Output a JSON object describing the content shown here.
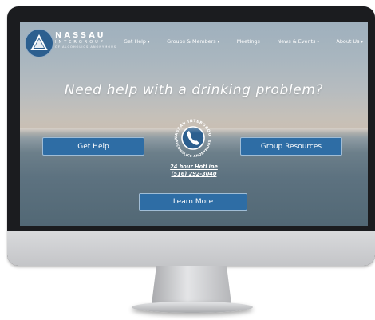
{
  "site": {
    "brand_name": "NASSAU",
    "brand_sub": "INTERGROUP",
    "brand_tag": "OF ALCOHOLICS ANONYMOUS"
  },
  "nav": {
    "items": [
      {
        "label": "Get Help",
        "has_dropdown": true
      },
      {
        "label": "Groups & Members",
        "has_dropdown": true
      },
      {
        "label": "Meetings",
        "has_dropdown": false
      },
      {
        "label": "News & Events",
        "has_dropdown": true
      },
      {
        "label": "About Us",
        "has_dropdown": true
      }
    ],
    "caret": "▾"
  },
  "hero": {
    "headline": "Need help with a drinking problem?",
    "get_help_label": "Get Help",
    "group_resources_label": "Group Resources",
    "learn_more_label": "Learn More",
    "badge_top_text": "NASSAU INTERGROUP",
    "badge_bottom_text": "ALCOHOLICS ANONYMOUS",
    "hotline_title": "24 hour HotLine",
    "hotline_number": "(516) 292-3040"
  },
  "icons": {
    "logo": "triangle-in-circle-logo",
    "badge": "phone-icon"
  },
  "colors": {
    "accent": "#2e6da5",
    "logo_blue": "#2c5f8f",
    "bezel": "#1b1c1f",
    "chin": "#d3d4d6"
  }
}
